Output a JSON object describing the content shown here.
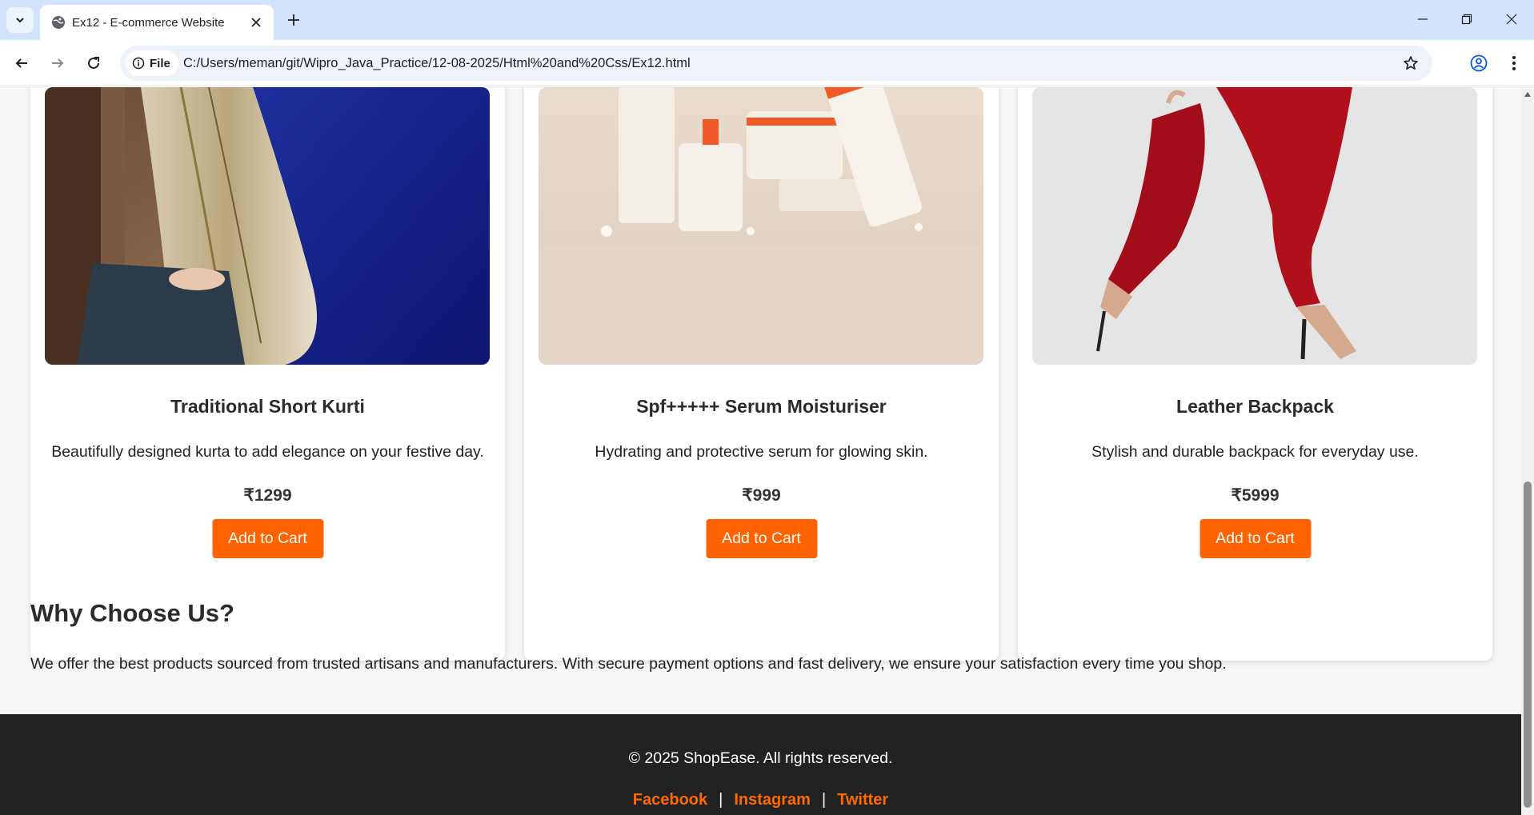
{
  "browser": {
    "tab_title": "Ex12 - E-commerce Website",
    "site_chip_label": "File",
    "url": "C:/Users/meman/git/Wipro_Java_Practice/12-08-2025/Html%20and%20Css/Ex12.html"
  },
  "icons": {
    "tab_list": "chevron-down-icon",
    "favicon": "globe-icon",
    "tab_close": "close-icon",
    "new_tab": "plus-icon",
    "minimize": "minimize-icon",
    "restore": "restore-icon",
    "close_window": "close-icon",
    "back": "arrow-left-icon",
    "forward": "arrow-right-icon",
    "reload": "reload-icon",
    "site_info": "info-icon",
    "bookmark": "star-icon",
    "profile": "profile-icon",
    "menu": "more-vert-icon"
  },
  "products": [
    {
      "title": "Traditional Short Kurti",
      "description": "Beautifully designed kurta to add elegance on your festive day.",
      "price": "₹1299",
      "button": "Add to Cart"
    },
    {
      "title": "Spf+++++ Serum Moisturiser",
      "description": "Hydrating and protective serum for glowing skin.",
      "price": "₹999",
      "button": "Add to Cart"
    },
    {
      "title": "Leather Backpack",
      "description": "Stylish and durable backpack for everyday use.",
      "price": "₹5999",
      "button": "Add to Cart"
    }
  ],
  "why": {
    "title": "Why Choose Us?",
    "text": "We offer the best products sourced from trusted artisans and manufacturers. With secure payment options and fast delivery, we ensure your satisfaction every time you shop."
  },
  "footer": {
    "copyright": "© 2025 ShopEase. All rights reserved.",
    "links": [
      "Facebook",
      "Instagram",
      "Twitter"
    ],
    "separator": "|"
  },
  "colors": {
    "accent": "#ff6200",
    "footer_bg": "#222222",
    "tabbar_bg": "#d3e3fd",
    "page_bg": "#f7f7f7"
  }
}
